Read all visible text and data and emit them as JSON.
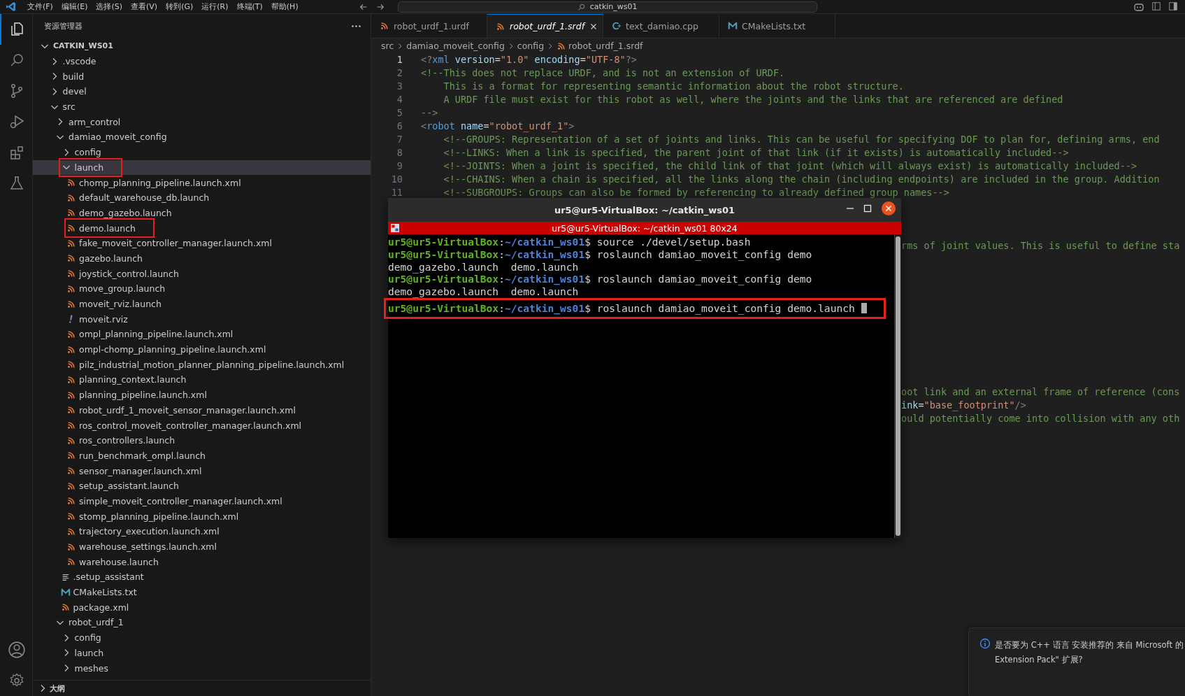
{
  "menu": [
    "文件(F)",
    "编辑(E)",
    "选择(S)",
    "查看(V)",
    "转到(G)",
    "运行(R)",
    "终端(T)",
    "帮助(H)"
  ],
  "command_center": {
    "label": "catkin_ws01"
  },
  "activity": [
    {
      "kind": "files",
      "selected": true
    },
    {
      "kind": "search",
      "selected": false
    },
    {
      "kind": "branch",
      "selected": false
    },
    {
      "kind": "debug",
      "selected": false
    },
    {
      "kind": "blocks",
      "selected": false
    },
    {
      "kind": "flask",
      "selected": false
    }
  ],
  "sidebar": {
    "title": "资源管理器",
    "tree": [
      {
        "label": "CATKIN_WS01",
        "kind": "root",
        "expanded": true,
        "selected": false,
        "annotated": false,
        "children": [
          {
            "label": ".vscode",
            "kind": "folder",
            "expanded": false,
            "selected": false,
            "annotated": false
          },
          {
            "label": "build",
            "kind": "folder",
            "expanded": false,
            "selected": false,
            "annotated": false
          },
          {
            "label": "devel",
            "kind": "folder",
            "expanded": false,
            "selected": false,
            "annotated": false
          },
          {
            "label": "src",
            "kind": "folder",
            "expanded": true,
            "selected": false,
            "annotated": false,
            "children": [
              {
                "label": "arm_control",
                "kind": "folder",
                "expanded": false,
                "selected": false,
                "annotated": false
              },
              {
                "label": "damiao_moveit_config",
                "kind": "folder",
                "expanded": true,
                "selected": false,
                "annotated": false,
                "children": [
                  {
                    "label": "config",
                    "kind": "folder",
                    "expanded": false,
                    "selected": false,
                    "annotated": false
                  },
                  {
                    "label": "launch",
                    "kind": "folder",
                    "expanded": true,
                    "selected": true,
                    "annotated": true,
                    "children": [
                      {
                        "label": "chomp_planning_pipeline.launch.xml",
                        "kind": "rss",
                        "selected": false,
                        "annotated": false
                      },
                      {
                        "label": "default_warehouse_db.launch",
                        "kind": "rss",
                        "selected": false,
                        "annotated": false
                      },
                      {
                        "label": "demo_gazebo.launch",
                        "kind": "rss",
                        "selected": false,
                        "annotated": false
                      },
                      {
                        "label": "demo.launch",
                        "kind": "rss",
                        "selected": false,
                        "annotated": true
                      },
                      {
                        "label": "fake_moveit_controller_manager.launch.xml",
                        "kind": "rss",
                        "selected": false,
                        "annotated": false
                      },
                      {
                        "label": "gazebo.launch",
                        "kind": "rss",
                        "selected": false,
                        "annotated": false
                      },
                      {
                        "label": "joystick_control.launch",
                        "kind": "rss",
                        "selected": false,
                        "annotated": false
                      },
                      {
                        "label": "move_group.launch",
                        "kind": "rss",
                        "selected": false,
                        "annotated": false
                      },
                      {
                        "label": "moveit_rviz.launch",
                        "kind": "rss",
                        "selected": false,
                        "annotated": false
                      },
                      {
                        "label": "moveit.rviz",
                        "kind": "rviz",
                        "selected": false,
                        "annotated": false
                      },
                      {
                        "label": "ompl_planning_pipeline.launch.xml",
                        "kind": "rss",
                        "selected": false,
                        "annotated": false
                      },
                      {
                        "label": "ompl-chomp_planning_pipeline.launch.xml",
                        "kind": "rss",
                        "selected": false,
                        "annotated": false
                      },
                      {
                        "label": "pilz_industrial_motion_planner_planning_pipeline.launch.xml",
                        "kind": "rss",
                        "selected": false,
                        "annotated": false
                      },
                      {
                        "label": "planning_context.launch",
                        "kind": "rss",
                        "selected": false,
                        "annotated": false
                      },
                      {
                        "label": "planning_pipeline.launch.xml",
                        "kind": "rss",
                        "selected": false,
                        "annotated": false
                      },
                      {
                        "label": "robot_urdf_1_moveit_sensor_manager.launch.xml",
                        "kind": "rss",
                        "selected": false,
                        "annotated": false
                      },
                      {
                        "label": "ros_control_moveit_controller_manager.launch.xml",
                        "kind": "rss",
                        "selected": false,
                        "annotated": false
                      },
                      {
                        "label": "ros_controllers.launch",
                        "kind": "rss",
                        "selected": false,
                        "annotated": false
                      },
                      {
                        "label": "run_benchmark_ompl.launch",
                        "kind": "rss",
                        "selected": false,
                        "annotated": false
                      },
                      {
                        "label": "sensor_manager.launch.xml",
                        "kind": "rss",
                        "selected": false,
                        "annotated": false
                      },
                      {
                        "label": "setup_assistant.launch",
                        "kind": "rss",
                        "selected": false,
                        "annotated": false
                      },
                      {
                        "label": "simple_moveit_controller_manager.launch.xml",
                        "kind": "rss",
                        "selected": false,
                        "annotated": false
                      },
                      {
                        "label": "stomp_planning_pipeline.launch.xml",
                        "kind": "rss",
                        "selected": false,
                        "annotated": false
                      },
                      {
                        "label": "trajectory_execution.launch.xml",
                        "kind": "rss",
                        "selected": false,
                        "annotated": false
                      },
                      {
                        "label": "warehouse_settings.launch.xml",
                        "kind": "rss",
                        "selected": false,
                        "annotated": false
                      },
                      {
                        "label": "warehouse.launch",
                        "kind": "rss",
                        "selected": false,
                        "annotated": false
                      }
                    ]
                  },
                  {
                    "label": ".setup_assistant",
                    "kind": "list",
                    "selected": false,
                    "annotated": false
                  },
                  {
                    "label": "CMakeLists.txt",
                    "kind": "cmake",
                    "selected": false,
                    "annotated": false
                  },
                  {
                    "label": "package.xml",
                    "kind": "rss",
                    "selected": false,
                    "annotated": false
                  }
                ]
              },
              {
                "label": "robot_urdf_1",
                "kind": "folder",
                "expanded": true,
                "selected": false,
                "annotated": false,
                "children": [
                  {
                    "label": "config",
                    "kind": "folder",
                    "expanded": false,
                    "selected": false,
                    "annotated": false
                  },
                  {
                    "label": "launch",
                    "kind": "folder",
                    "expanded": false,
                    "selected": false,
                    "annotated": false
                  },
                  {
                    "label": "meshes",
                    "kind": "folder",
                    "expanded": false,
                    "selected": false,
                    "annotated": false
                  }
                ]
              }
            ]
          }
        ]
      }
    ],
    "outline": {
      "label": "大纲",
      "expanded": false
    }
  },
  "tabs": [
    {
      "label": "robot_urdf_1.urdf",
      "kind": "rss",
      "selected": false,
      "preview": false
    },
    {
      "label": "robot_urdf_1.srdf",
      "kind": "rss",
      "selected": true,
      "preview": true
    },
    {
      "label": "text_damiao.cpp",
      "kind": "cpp",
      "selected": false,
      "preview": false
    },
    {
      "label": "CMakeLists.txt",
      "kind": "cmake",
      "selected": false,
      "preview": false
    }
  ],
  "breadcrumb": [
    {
      "label": "src",
      "kind": "folder"
    },
    {
      "label": "damiao_moveit_config",
      "kind": "folder"
    },
    {
      "label": "config",
      "kind": "folder"
    },
    {
      "label": "robot_urdf_1.srdf",
      "kind": "rss"
    }
  ],
  "editor": {
    "lines": [
      {
        "number": "1",
        "current": true,
        "tokens": [
          {
            "kind": "punct",
            "text": "<?"
          },
          {
            "kind": "tag",
            "text": "xml"
          },
          {
            "kind": "attr",
            "text": " version"
          },
          {
            "kind": "plain",
            "text": "="
          },
          {
            "kind": "string",
            "text": "\"1.0\""
          },
          {
            "kind": "attr",
            "text": " encoding"
          },
          {
            "kind": "plain",
            "text": "="
          },
          {
            "kind": "string",
            "text": "\"UTF-8\""
          },
          {
            "kind": "punct",
            "text": "?>"
          }
        ]
      },
      {
        "number": "2",
        "current": false,
        "tokens": [
          {
            "kind": "comment",
            "text": "<!--This does not replace URDF, and is not an extension of URDF."
          }
        ]
      },
      {
        "number": "3",
        "current": false,
        "tokens": [
          {
            "kind": "comment",
            "text": "    This is a format for representing semantic information about the robot structure."
          }
        ]
      },
      {
        "number": "4",
        "current": false,
        "tokens": [
          {
            "kind": "comment",
            "text": "    A URDF file must exist for this robot as well, where the joints and the links that are referenced are defined"
          }
        ]
      },
      {
        "number": "5",
        "current": false,
        "tokens": [
          {
            "kind": "comment",
            "text": "-->"
          }
        ]
      },
      {
        "number": "6",
        "current": false,
        "tokens": [
          {
            "kind": "punct",
            "text": "<"
          },
          {
            "kind": "tag",
            "text": "robot"
          },
          {
            "kind": "attr",
            "text": " name"
          },
          {
            "kind": "plain",
            "text": "="
          },
          {
            "kind": "string",
            "text": "\"robot_urdf_1\""
          },
          {
            "kind": "punct",
            "text": ">"
          }
        ]
      },
      {
        "number": "7",
        "current": false,
        "tokens": [
          {
            "kind": "comment",
            "text": "    <!--GROUPS: Representation of a set of joints and links. This can be useful for specifying DOF to plan for, defining arms, end"
          }
        ]
      },
      {
        "number": "8",
        "current": false,
        "tokens": [
          {
            "kind": "comment",
            "text": "    <!--LINKS: When a link is specified, the parent joint of that link (if it exists) is automatically included-->"
          }
        ]
      },
      {
        "number": "9",
        "current": false,
        "tokens": [
          {
            "kind": "comment",
            "text": "    <!--JOINTS: When a joint is specified, the child link of that joint (which will always exist) is automatically included-->"
          }
        ]
      },
      {
        "number": "10",
        "current": false,
        "tokens": [
          {
            "kind": "comment",
            "text": "    <!--CHAINS: When a chain is specified, all the links along the chain (including endpoints) are included in the group. Addition"
          }
        ]
      },
      {
        "number": "11",
        "current": false,
        "tokens": [
          {
            "kind": "comment",
            "text": "    <!--SUBGROUPS: Groups can also be formed by referencing to already defined group names-->"
          }
        ]
      }
    ],
    "fragments": [
      {
        "tokens": [
          {
            "kind": "comment",
            "text": "rms of joint values. This is useful to define sta"
          }
        ]
      },
      {
        "tokens": [
          {
            "kind": "comment",
            "text": "oot link and an external frame of reference (cons"
          }
        ]
      },
      {
        "tokens": [
          {
            "kind": "attr",
            "text": "ink"
          },
          {
            "kind": "plain",
            "text": "="
          },
          {
            "kind": "string",
            "text": "\"base_footprint\""
          },
          {
            "kind": "punct",
            "text": "/>"
          }
        ]
      },
      {
        "tokens": [
          {
            "kind": "comment",
            "text": "ould potentially come into collision with any oth"
          }
        ]
      }
    ]
  },
  "terminal": {
    "title": "ur5@ur5-VirtualBox: ~/catkin_ws01",
    "tab_title": "ur5@ur5-VirtualBox: ~/catkin_ws01 80x24",
    "lines": [
      {
        "annotated": false,
        "cursor": false,
        "tokens": [
          {
            "kind": "user",
            "text": "ur5@ur5-VirtualBox"
          },
          {
            "kind": "plain",
            "text": ":"
          },
          {
            "kind": "path",
            "text": "~/catkin_ws01"
          },
          {
            "kind": "plain",
            "text": "$ source ./devel/setup.bash"
          }
        ]
      },
      {
        "annotated": false,
        "cursor": false,
        "tokens": [
          {
            "kind": "user",
            "text": "ur5@ur5-VirtualBox"
          },
          {
            "kind": "plain",
            "text": ":"
          },
          {
            "kind": "path",
            "text": "~/catkin_ws01"
          },
          {
            "kind": "plain",
            "text": "$ roslaunch damiao_moveit_config demo"
          }
        ]
      },
      {
        "annotated": false,
        "cursor": false,
        "tokens": [
          {
            "kind": "plain",
            "text": "demo_gazebo.launch  demo.launch"
          }
        ]
      },
      {
        "annotated": false,
        "cursor": false,
        "tokens": [
          {
            "kind": "user",
            "text": "ur5@ur5-VirtualBox"
          },
          {
            "kind": "plain",
            "text": ":"
          },
          {
            "kind": "path",
            "text": "~/catkin_ws01"
          },
          {
            "kind": "plain",
            "text": "$ roslaunch damiao_moveit_config demo"
          }
        ]
      },
      {
        "annotated": false,
        "cursor": false,
        "tokens": [
          {
            "kind": "plain",
            "text": "demo_gazebo.launch  demo.launch"
          }
        ]
      },
      {
        "annotated": true,
        "cursor": true,
        "tokens": [
          {
            "kind": "user",
            "text": "ur5@ur5-VirtualBox"
          },
          {
            "kind": "plain",
            "text": ":"
          },
          {
            "kind": "path",
            "text": "~/catkin_ws01"
          },
          {
            "kind": "plain",
            "text": "$ roslaunch damiao_moveit_config demo.launch"
          }
        ]
      }
    ]
  },
  "notification": {
    "lines": [
      "是否要为 C++ 语言 安装推荐的 来自 Microsoft 的",
      "Extension Pack\" 扩展?"
    ]
  }
}
